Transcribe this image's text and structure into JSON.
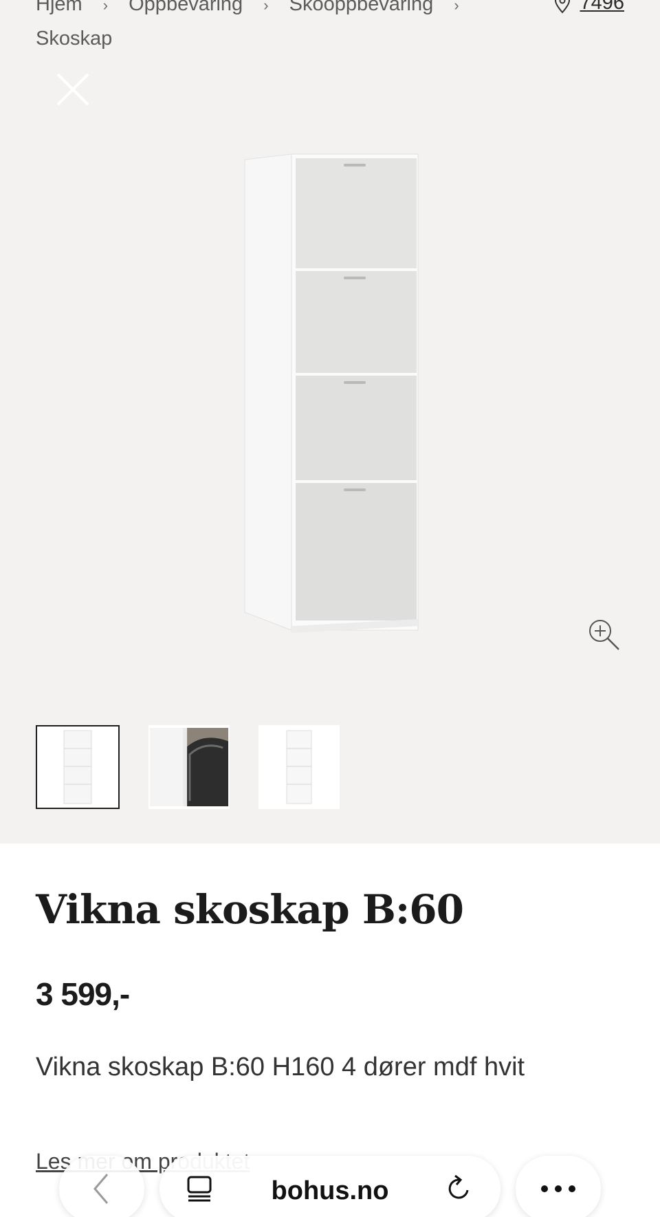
{
  "breadcrumb": {
    "items": [
      "Hjem",
      "Oppbevaring",
      "Skooppbevaring"
    ],
    "current": "Skoskap"
  },
  "location": {
    "zip": "7496",
    "icon": "location-pin-icon"
  },
  "gallery": {
    "close_icon": "close-icon",
    "zoom_icon": "zoom-in-icon",
    "thumbnails": [
      "thumbnail-1",
      "thumbnail-2",
      "thumbnail-3"
    ]
  },
  "product": {
    "title": "Vikna skoskap B:60",
    "price": "3 599,-",
    "description": "Vikna skoskap B:60 H160 4 dører mdf hvit",
    "read_more": "Les mer om produktet"
  },
  "browser": {
    "domain": "bohus.no",
    "back_icon": "chevron-left-icon",
    "tabs_icon": "tabs-icon",
    "reload_icon": "reload-icon",
    "more_icon": "more-icon"
  }
}
